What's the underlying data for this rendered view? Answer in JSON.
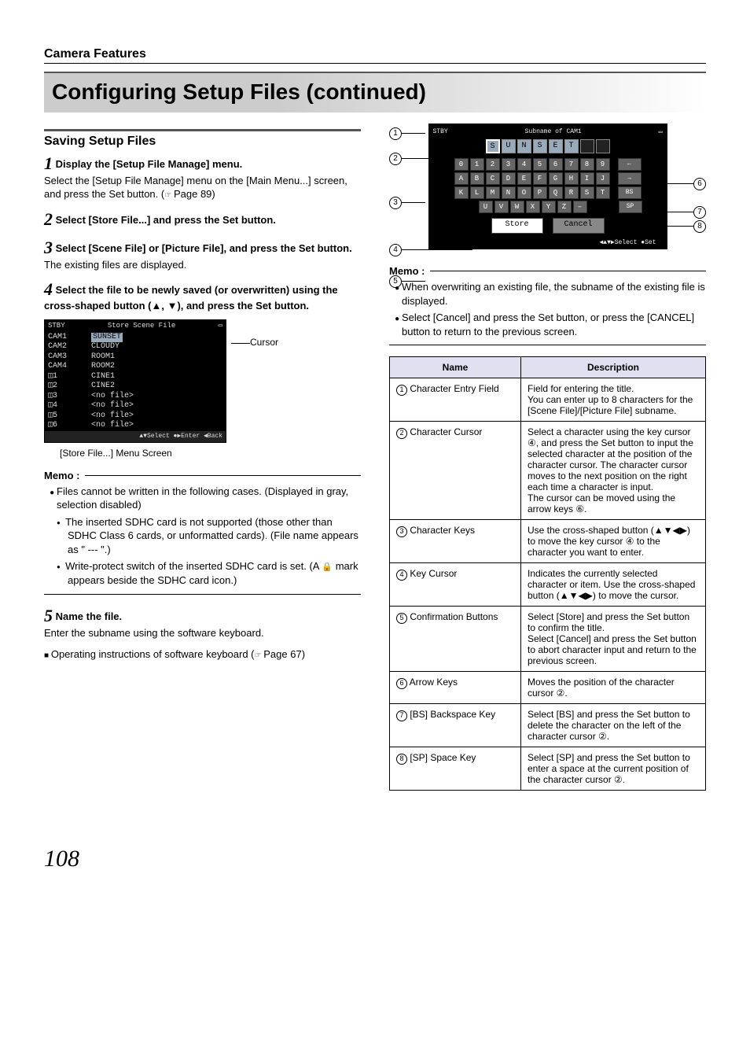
{
  "header": {
    "section": "Camera Features"
  },
  "title": "Configuring Setup Files (continued)",
  "left": {
    "subhead": "Saving Setup Files",
    "steps": {
      "s1": {
        "num": "1",
        "title": "Display the [Setup File Manage] menu.",
        "body": "Select the [Setup File Manage] menu on the [Main Menu...] screen, and press the Set button. (",
        "ref": "Page 89)"
      },
      "s2": {
        "num": "2",
        "title": "Select [Store File...] and press the Set button."
      },
      "s3": {
        "num": "3",
        "title": "Select [Scene File] or [Picture File], and press the Set button.",
        "body": "The existing files are displayed."
      },
      "s4": {
        "num": "4",
        "title": "Select the file to be newly saved (or overwritten) using the cross-shaped button (▲, ▼), and press the Set button."
      },
      "s5": {
        "num": "5",
        "title": "Name the file.",
        "body": "Enter the subname using the software keyboard.",
        "extra": "Operating instructions of software keyboard (",
        "ref": "Page 67)"
      }
    },
    "osd": {
      "stby": "STBY",
      "title": "Store Scene File",
      "cursor_label": "Cursor",
      "rows": [
        {
          "c1": "CAM1",
          "c2": "SUNSET",
          "hl": true
        },
        {
          "c1": "CAM2",
          "c2": "CLOUDY"
        },
        {
          "c1": "CAM3",
          "c2": "ROOM1"
        },
        {
          "c1": "CAM4",
          "c2": "ROOM2"
        },
        {
          "c1": "◫1",
          "c2": "CINE1"
        },
        {
          "c1": "◫2",
          "c2": "CINE2"
        },
        {
          "c1": "◫3",
          "c2": "<no file>"
        },
        {
          "c1": "◫4",
          "c2": "<no file>"
        },
        {
          "c1": "◫5",
          "c2": "<no file>"
        },
        {
          "c1": "◫6",
          "c2": "<no file>"
        }
      ],
      "footer": "▲▼Select  ●▶Enter  ◀Back",
      "caption": "[Store File...] Menu Screen"
    },
    "memo": {
      "label": "Memo :",
      "main": "Files cannot be written in the following cases. (Displayed in gray, selection disabled)",
      "sub1": "The inserted SDHC card is not supported (those other than SDHC Class 6 cards, or unformatted cards). (File name appears as \" --- \".)",
      "sub2_a": "Write-protect switch of the inserted SDHC card is set. (A ",
      "sub2_b": " mark appears beside the SDHC card icon.)"
    }
  },
  "right": {
    "kb": {
      "stby": "STBY",
      "subname_label": "Subname",
      "of_label": "of CAM1",
      "entry": [
        "S",
        "U",
        "N",
        "S",
        "E",
        "T",
        "",
        ""
      ],
      "row_digits": [
        "0",
        "1",
        "2",
        "3",
        "4",
        "5",
        "6",
        "7",
        "8",
        "9"
      ],
      "row_a": [
        "A",
        "B",
        "C",
        "D",
        "E",
        "F",
        "G",
        "H",
        "I",
        "J"
      ],
      "row_k": [
        "K",
        "L",
        "M",
        "N",
        "O",
        "P",
        "Q",
        "R",
        "S",
        "T"
      ],
      "row_u": [
        "U",
        "V",
        "W",
        "X",
        "Y",
        "Z",
        "–"
      ],
      "arrow_left": "←",
      "arrow_right": "→",
      "bs": "BS",
      "sp": "SP",
      "store": "Store",
      "cancel": "Cancel",
      "nav": "◀▲▼▶Select   ●Set"
    },
    "callouts": {
      "c1": "1",
      "c2": "2",
      "c3": "3",
      "c4": "4",
      "c5": "5",
      "c6": "6",
      "c7": "7",
      "c8": "8"
    },
    "memo": {
      "label": "Memo :",
      "i1": "When overwriting an existing file, the subname of the existing file is displayed.",
      "i2": "Select [Cancel] and press the Set button, or press the [CANCEL] button to return to the previous screen."
    },
    "table": {
      "h1": "Name",
      "h2": "Description",
      "rows": [
        {
          "n": "1",
          "name": "Character Entry Field",
          "desc": "Field for entering the title.\nYou can enter up to 8 characters for the [Scene File]/[Picture File] subname."
        },
        {
          "n": "2",
          "name": "Character Cursor",
          "desc": "Select a character using the key cursor ④, and press the Set button to input the selected character at the position of the character cursor. The character cursor moves to the next position on the right each time a character is input.\nThe cursor can be moved using the arrow keys ⑥."
        },
        {
          "n": "3",
          "name": "Character Keys",
          "desc": "Use the cross-shaped button (▲▼◀▶) to move the key cursor ④ to the character you want to enter."
        },
        {
          "n": "4",
          "name": "Key Cursor",
          "desc": "Indicates the currently selected character or item. Use the cross-shaped button (▲▼◀▶) to move the cursor."
        },
        {
          "n": "5",
          "name": "Confirmation Buttons",
          "desc": "Select [Store] and press the Set button to confirm the title.\nSelect [Cancel] and press the Set button to abort character input and return to the previous screen."
        },
        {
          "n": "6",
          "name": "Arrow Keys",
          "desc": "Moves the position of the character cursor ②."
        },
        {
          "n": "7",
          "name": "[BS] Backspace Key",
          "desc": "Select [BS] and press the Set button to delete the character on the left of the character cursor ②."
        },
        {
          "n": "8",
          "name": "[SP] Space Key",
          "desc": "Select [SP] and press the Set button to enter a space at the current position of the character cursor ②."
        }
      ]
    }
  },
  "page_number": "108"
}
